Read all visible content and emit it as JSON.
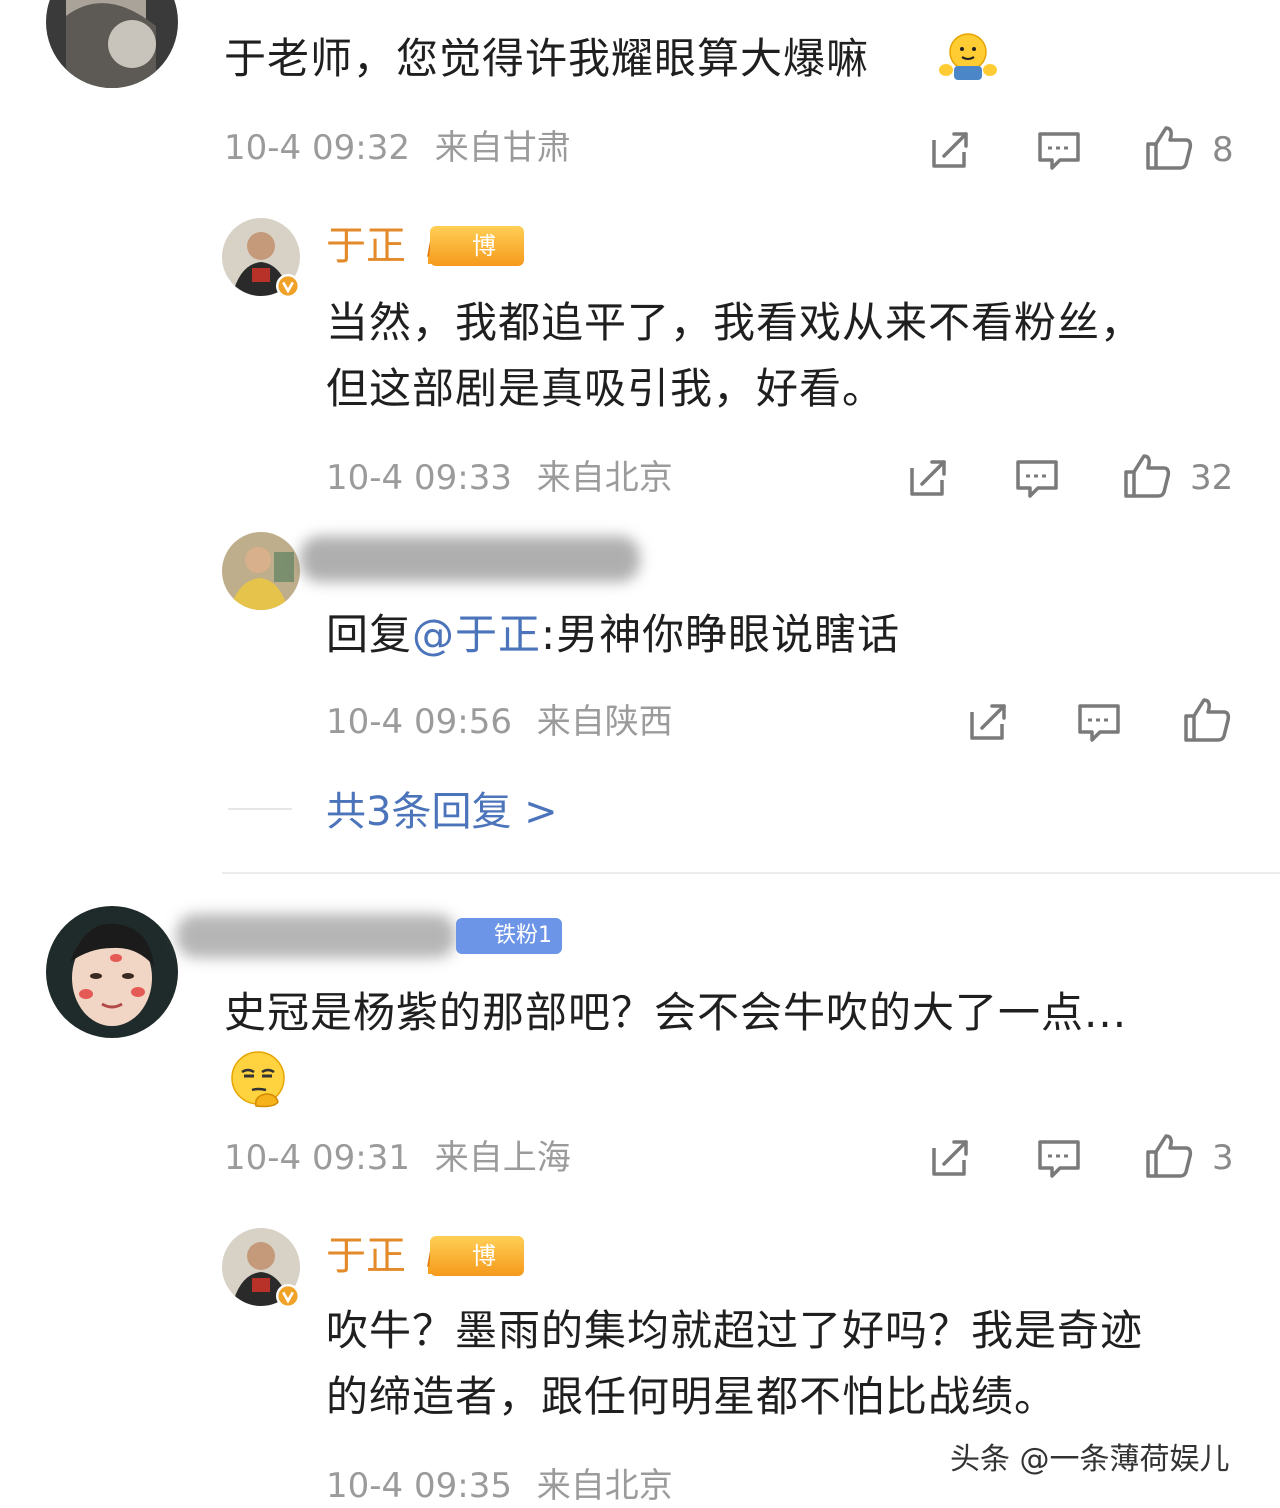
{
  "comments": [
    {
      "text": "于老师，您觉得许我耀眼算大爆嘛",
      "time": "10-4 09:32",
      "location": "来自甘肃",
      "likes": "8",
      "emoji": "hug-emoji"
    },
    {
      "reply_name": "于正",
      "badge": "博主",
      "text_line1": "当然，我都追平了，我看戏从来不看粉丝，",
      "text_line2": "但这部剧是真吸引我，好看。",
      "time": "10-4 09:33",
      "location": "来自北京",
      "likes": "32"
    },
    {
      "reply_prefix": "回复",
      "mention": "@于正",
      "reply_text": ":男神你睁眼说瞎话",
      "time": "10-4 09:56",
      "location": "来自陕西"
    },
    {
      "more_replies": "共3条回复 >"
    },
    {
      "fan_badge": "铁粉1",
      "text_line1": "史冠是杨紫的那部吧？会不会牛吹的大了一点...",
      "time": "10-4 09:31",
      "location": "来自上海",
      "likes": "3",
      "emoji": "thinking-emoji"
    },
    {
      "reply_name": "于正",
      "badge": "博主",
      "text_line1": "吹牛？墨雨的集均就超过了好吗？我是奇迹",
      "text_line2": "的缔造者，跟任何明星都不怕比战绩。",
      "time": "10-4 09:35",
      "location": "来自北京"
    }
  ],
  "watermark": "头条 @一条薄荷娱儿",
  "colors": {
    "gold": "#e38a2b",
    "link": "#4b74ba",
    "meta": "#9b9b9b"
  }
}
